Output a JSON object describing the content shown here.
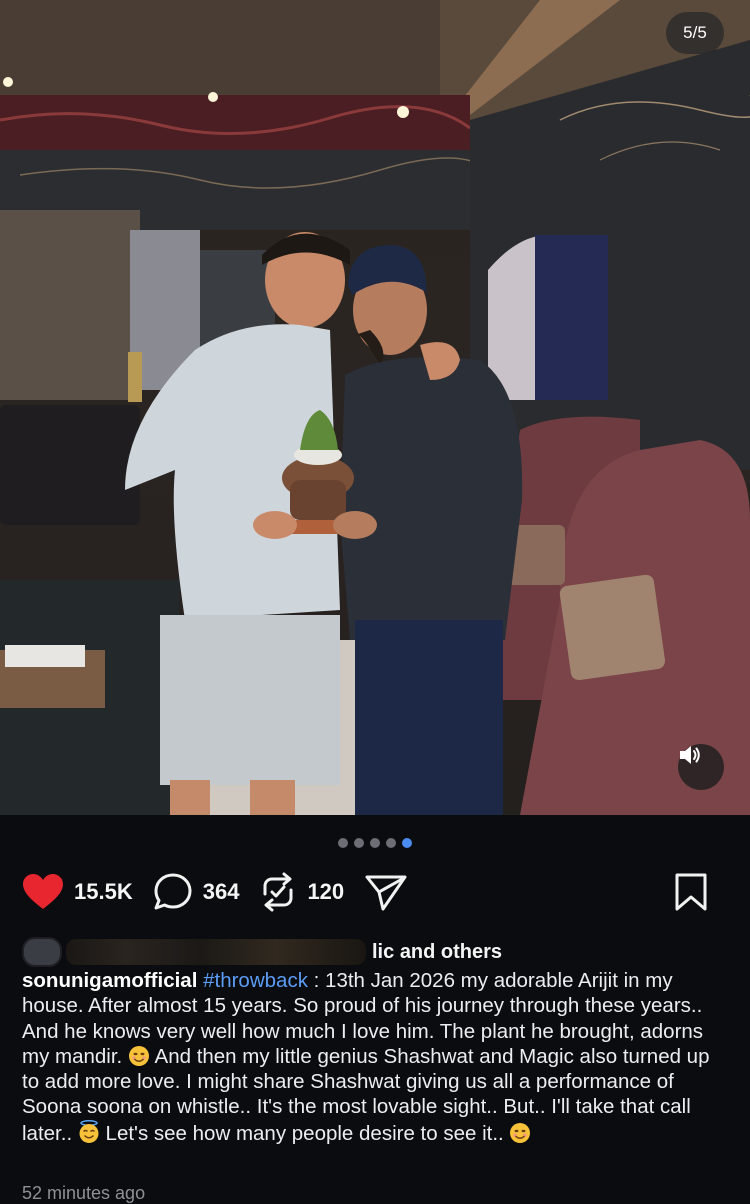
{
  "photo": {
    "page_counter": "5/5",
    "alt_icon": "photo-of-two-men-holding-plant-pot",
    "carousel_total": 5,
    "carousel_active_index": 4
  },
  "actions": {
    "like_count": "15.5K",
    "comment_count": "364",
    "repost_count": "120",
    "like_icon": "heart-icon",
    "comment_icon": "comment-icon",
    "repost_icon": "repost-icon",
    "share_icon": "send-icon",
    "save_icon": "bookmark-icon",
    "like_color": "#e8262f"
  },
  "likes": {
    "visible_fragment": "lic",
    "suffix": "and others"
  },
  "caption": {
    "username": "sonunigamofficial",
    "hashtag": "#throwback",
    "part1": " : 13th Jan 2026 my adorable Arijit in my house. After almost 15 years. So proud of his journey through these years.. And he knows very well how much I love him. The plant he brought, adorns my mandir. ",
    "emoji1": "smiling-face-emoji",
    "part2": " And then my little genius Shashwat and Magic also turned up to add more love. I might share Shashwat giving us all a performance of Soona soona on whistle.. It's the most lovable sight.. But.. I'll take that call later.. ",
    "emoji2": "halo-face-emoji",
    "part3": " Let's see how many people desire to see it.. ",
    "emoji3": "smiling-face-emoji"
  },
  "timestamp": "52 minutes ago",
  "colors": {
    "background": "#0b0c0f",
    "hashtag": "#5b9cf5",
    "active_dot": "#4a8cf0"
  }
}
